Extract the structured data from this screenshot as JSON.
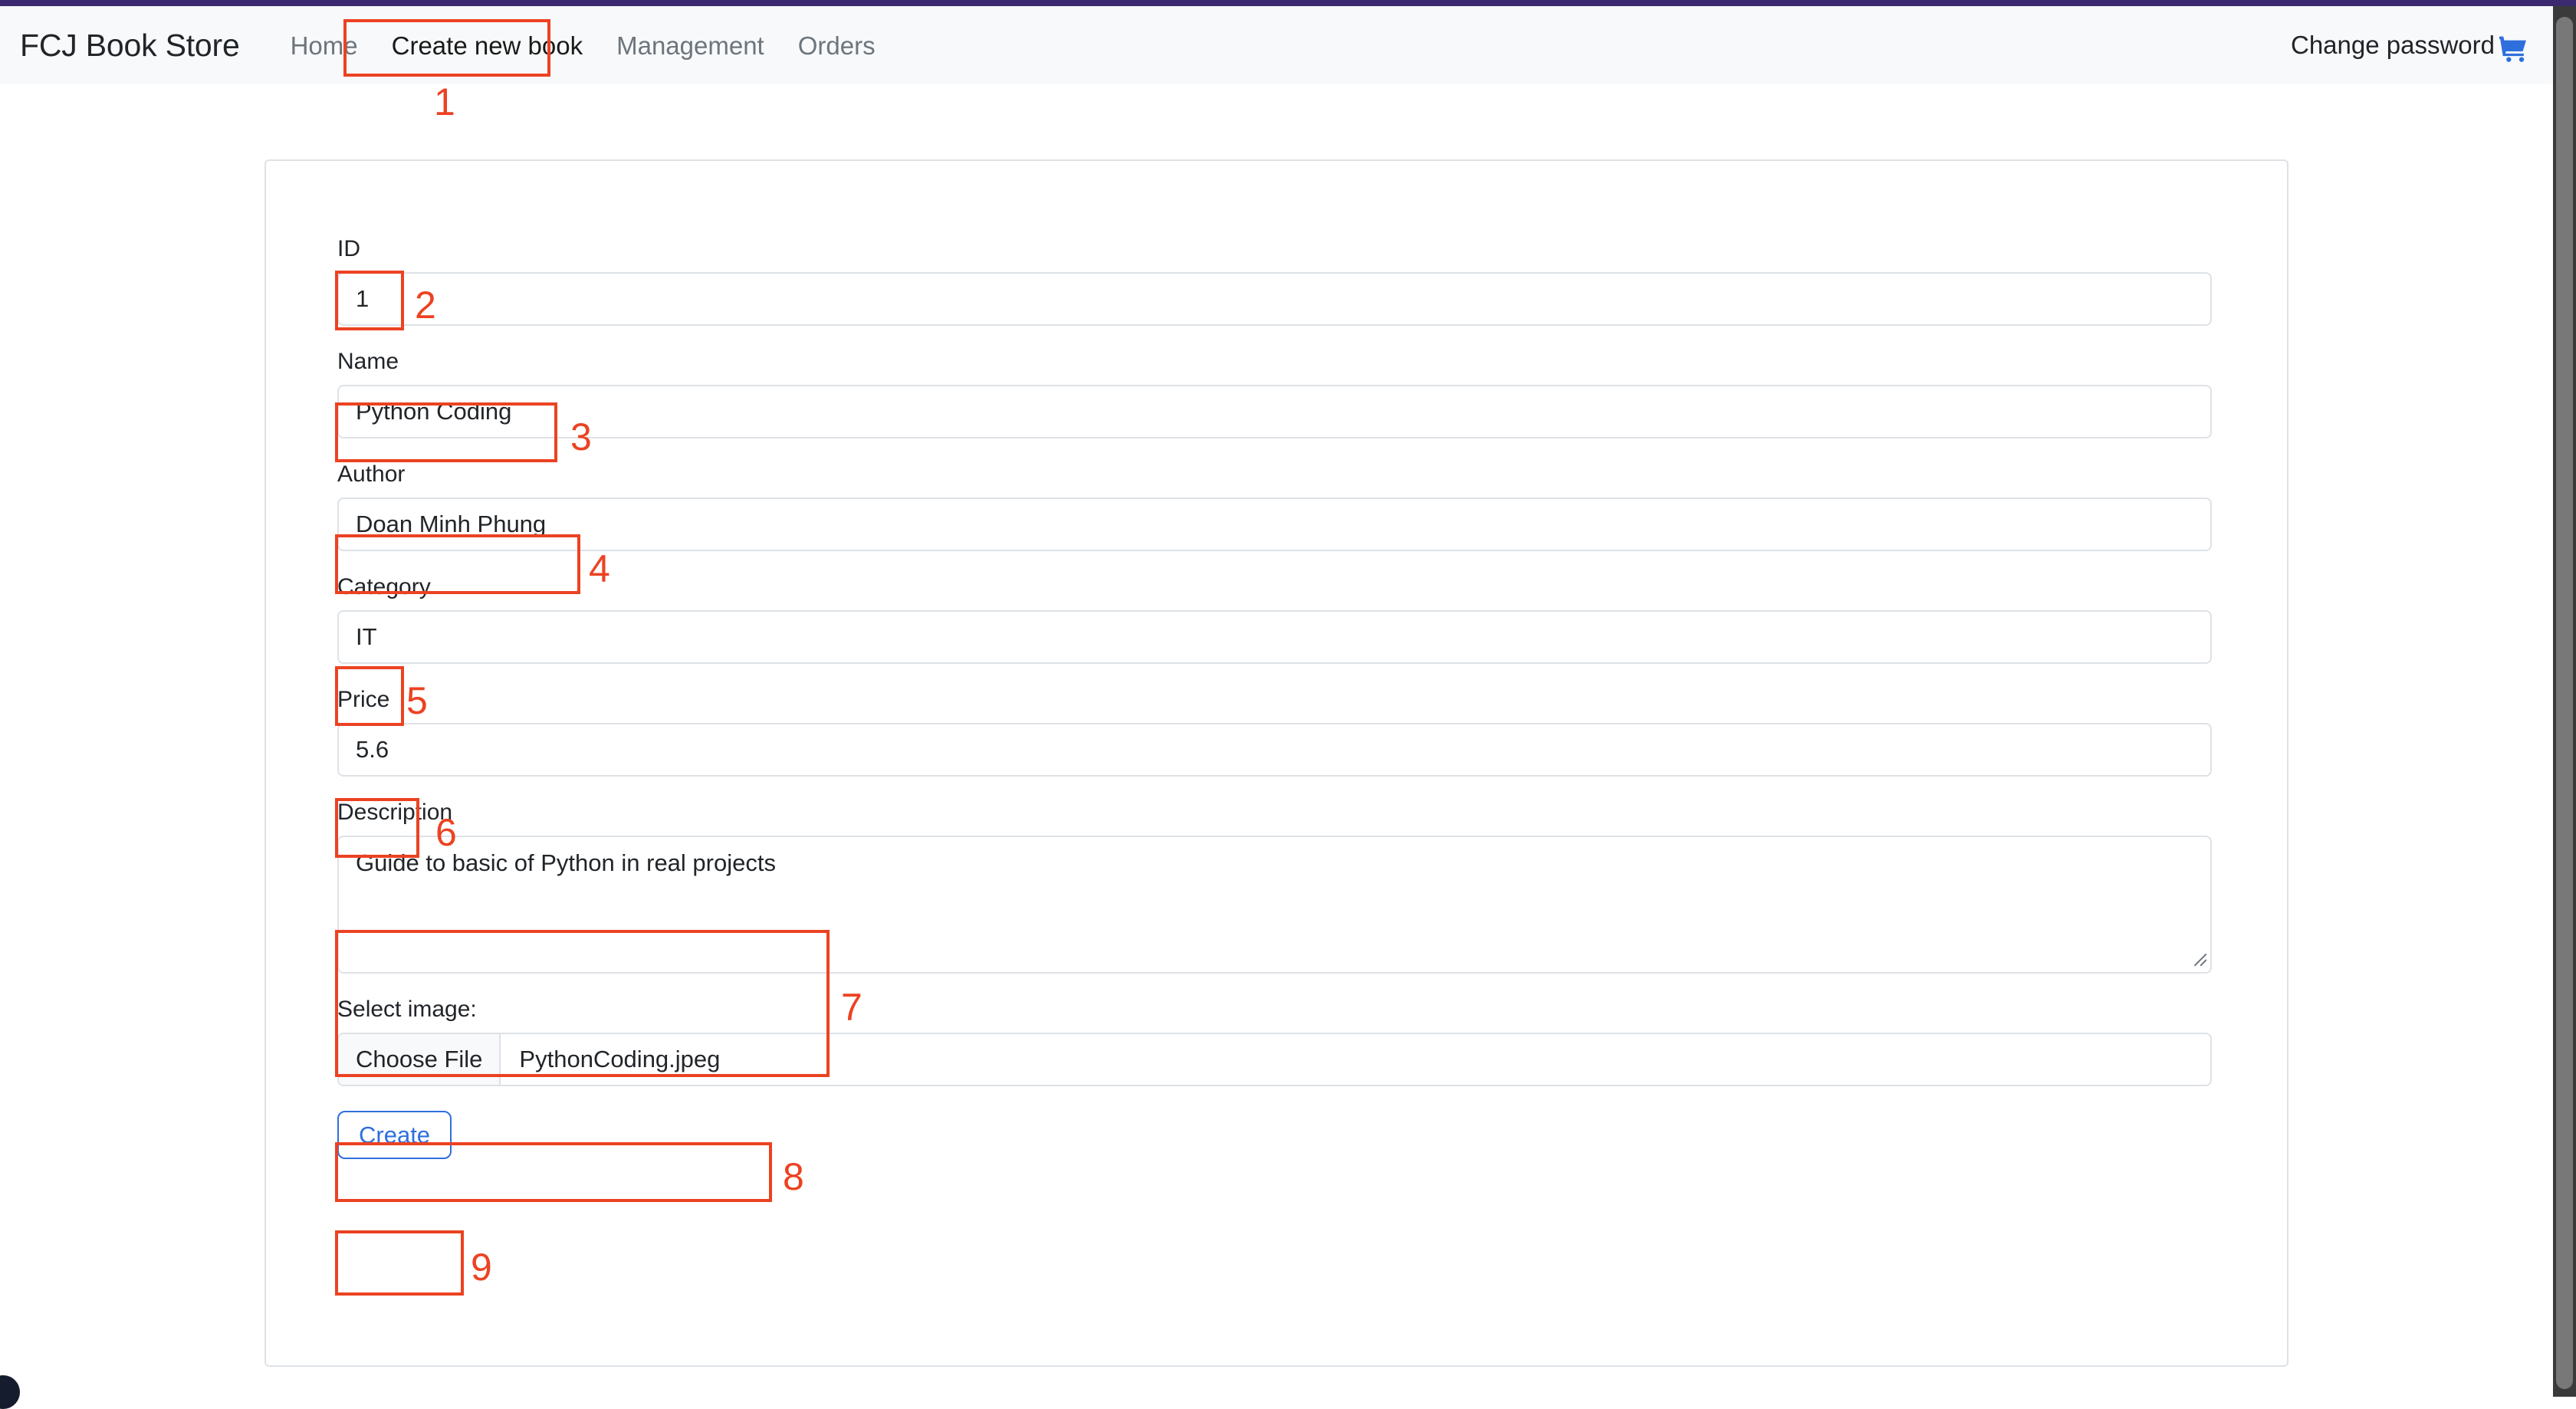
{
  "browser": {
    "top_strip_color": "#3c2a70",
    "scrollbar_present": "true"
  },
  "navbar": {
    "brand": "FCJ Book Store",
    "links": [
      {
        "label": "Home",
        "active": "false"
      },
      {
        "label": "Create new book",
        "active": "true"
      },
      {
        "label": "Management",
        "active": "false"
      },
      {
        "label": "Orders",
        "active": "false"
      }
    ],
    "right": {
      "change_password_label": "Change password",
      "cart_icon": "shopping-cart-icon",
      "cart_color": "#2f6fdd"
    }
  },
  "form": {
    "fields": [
      {
        "label": "ID",
        "value": "1",
        "type": "text"
      },
      {
        "label": "Name",
        "value": "Python Coding",
        "type": "text"
      },
      {
        "label": "Author",
        "value": "Doan Minh Phung",
        "type": "text"
      },
      {
        "label": "Category",
        "value": "IT",
        "type": "text"
      },
      {
        "label": "Price",
        "value": "5.6",
        "type": "text"
      },
      {
        "label": "Description",
        "value": "Guide to basic of Python in real projects",
        "type": "textarea"
      }
    ],
    "file_field": {
      "label": "Select image:",
      "button_label": "Choose File",
      "file_name": "PythonCoding.jpeg"
    },
    "submit": {
      "label": "Create",
      "color": "#2f6fdd"
    }
  },
  "annotations": {
    "color": "#ec4222",
    "markers": [
      {
        "number": "1",
        "target": "nav-link-create-new-book"
      },
      {
        "number": "2",
        "target": "id-input"
      },
      {
        "number": "3",
        "target": "name-input"
      },
      {
        "number": "4",
        "target": "author-input"
      },
      {
        "number": "5",
        "target": "category-input"
      },
      {
        "number": "6",
        "target": "price-input"
      },
      {
        "number": "7",
        "target": "description-textarea"
      },
      {
        "number": "8",
        "target": "file-input"
      },
      {
        "number": "9",
        "target": "create-button"
      }
    ]
  }
}
